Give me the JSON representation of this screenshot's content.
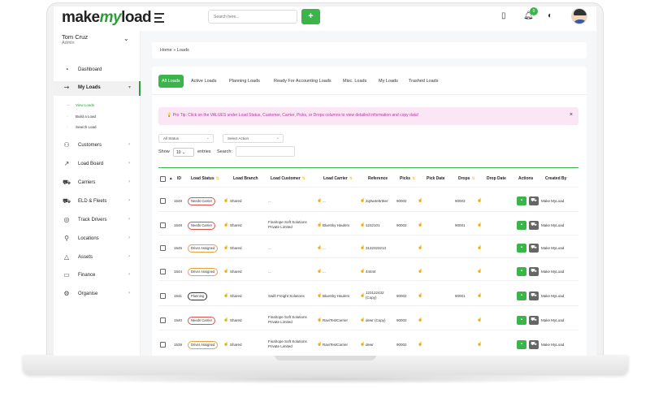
{
  "brand": {
    "logo_make": "make",
    "logo_my": "my",
    "logo_load": "load"
  },
  "topbar": {
    "search_placeholder": "Search here...",
    "add_label": "+",
    "notification_count": "0"
  },
  "user": {
    "name": "Tom Cruz",
    "role": "Admin"
  },
  "sidebar": {
    "items": [
      {
        "label": "Dashboard",
        "icon": "dashboard-icon",
        "glyph": "◔"
      },
      {
        "label": "My Loads",
        "icon": "truck-arrow-icon",
        "glyph": "⇝"
      },
      {
        "label": "Customers",
        "icon": "customers-icon",
        "glyph": "⚇"
      },
      {
        "label": "Load Board",
        "icon": "chart-icon",
        "glyph": "↗"
      },
      {
        "label": "Carriers",
        "icon": "carrier-truck-icon",
        "glyph": "⛟"
      },
      {
        "label": "ELD & Fleets",
        "icon": "fleet-truck-icon",
        "glyph": "⛟"
      },
      {
        "label": "Track Drivers",
        "icon": "location-pin-icon",
        "glyph": "◎"
      },
      {
        "label": "Locations",
        "icon": "map-marker-icon",
        "glyph": "⚲"
      },
      {
        "label": "Assets",
        "icon": "assets-icon",
        "glyph": "△"
      },
      {
        "label": "Finance",
        "icon": "finance-icon",
        "glyph": "▭"
      },
      {
        "label": "Organise",
        "icon": "settings-icon",
        "glyph": "⚙"
      }
    ],
    "sub_items": [
      "View Loads",
      "Build a Load",
      "Search Load"
    ]
  },
  "breadcrumb": "Home  »  Loads",
  "tabs": [
    "All Loads",
    "Active Loads",
    "Planning Loads",
    "Ready For Accounting Loads",
    "Misc. Loads",
    "My Loads",
    "Trashed Loads"
  ],
  "tip": "💡 Pro Tip: Click on the VALUES under Load Status, Customer, Carrier, Picks, or Drops columns to view detailed information and copy data!",
  "filters": {
    "status": "All Status",
    "action": "Select Action"
  },
  "table_controls": {
    "show": "Show",
    "entries_value": "10",
    "entries": "entries",
    "search": "Search:"
  },
  "columns": [
    "ID",
    "Load Status",
    "Load Branch",
    "Load Customer",
    "Load Carrier",
    "Reference",
    "Picks",
    "Pick Date",
    "Drops",
    "Drop Date",
    "Actions",
    "Created By"
  ],
  "rows": [
    {
      "id": "1549",
      "status": "Needs Carrier",
      "branch": "Shared",
      "customer": "...",
      "carrier": "...",
      "reference": "2q3w4e5rt6er",
      "picks": "90002",
      "drops": "90003",
      "created_by": "Make MyLoad"
    },
    {
      "id": "1548",
      "status": "Needs Carrier",
      "branch": "Shared",
      "customer": "Finalrope Soft Solutions Private Limited",
      "carrier": "BlueSky Haulers",
      "reference": "1232101",
      "picks": "90002",
      "drops": "90001",
      "created_by": "Make MyLoad"
    },
    {
      "id": "1545",
      "status": "Driver Assigned",
      "branch": "Shared",
      "customer": "...",
      "carrier": "...",
      "reference": "3132323213",
      "picks": "",
      "drops": "",
      "created_by": "Make MyLoad"
    },
    {
      "id": "1544",
      "status": "Driver Assigned",
      "branch": "Shared",
      "customer": "...",
      "carrier": "...",
      "reference": "44444",
      "picks": "",
      "drops": "",
      "created_by": "Make MyLoad"
    },
    {
      "id": "1541",
      "status": "Planning",
      "branch": "Shared",
      "customer": "Swift Freight Solutions",
      "carrier": "BlueSky Haulers",
      "reference": "123122432 (Copy)",
      "picks": "90002",
      "drops": "90001",
      "created_by": "Make MyLoad"
    },
    {
      "id": "1540",
      "status": "Needs Carrier",
      "branch": "Shared",
      "customer": "Finalrope Soft Solutions Private Limited",
      "carrier": "RaviTestCarrier",
      "reference": "dewr (Copy)",
      "picks": "90002",
      "drops": "",
      "created_by": "Make MyLoad"
    },
    {
      "id": "1539",
      "status": "Driver Assigned",
      "branch": "Shared",
      "customer": "Finalrope Soft Solutions Private Limited",
      "carrier": "RaviTestCarrier",
      "reference": "dewr",
      "picks": "90002",
      "drops": "",
      "created_by": "Make MyLoad"
    }
  ],
  "colors": {
    "accent": "#3bb54a",
    "needs_carrier": "#d9534f",
    "driver_assigned": "#e8a23d",
    "tip_bg": "#fbe6f5"
  }
}
